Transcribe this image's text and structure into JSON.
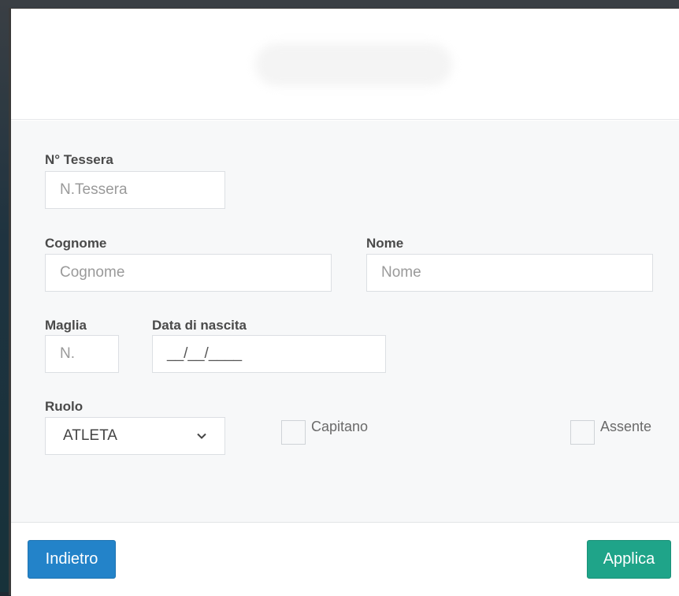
{
  "form": {
    "tessera": {
      "label": "N° Tessera",
      "placeholder": "N.Tessera"
    },
    "cognome": {
      "label": "Cognome",
      "placeholder": "Cognome"
    },
    "nome": {
      "label": "Nome",
      "placeholder": "Nome"
    },
    "maglia": {
      "label": "Maglia",
      "placeholder": "N."
    },
    "nascita": {
      "label": "Data di nascita",
      "placeholder": "__/__/____"
    },
    "ruolo": {
      "label": "Ruolo",
      "selected": "ATLETA"
    },
    "capitano": {
      "label": "Capitano",
      "checked": false
    },
    "assente": {
      "label": "Assente",
      "checked": false
    }
  },
  "footer": {
    "back_label": "Indietro",
    "apply_label": "Applica"
  },
  "colors": {
    "back_button": "#2383c9",
    "apply_button": "#1fa489"
  },
  "icons": {
    "select_arrow": "chevron-down-icon"
  }
}
